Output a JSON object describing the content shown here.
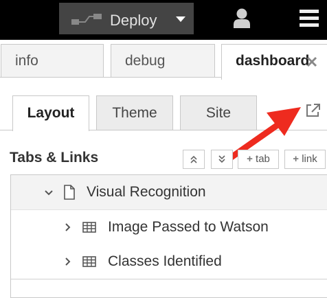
{
  "header": {
    "deploy_label": "Deploy",
    "icons": [
      "flow-icon",
      "caret-down-icon",
      "user-icon",
      "hamburger-menu-icon"
    ]
  },
  "sidebar": {
    "tabs": [
      {
        "label": "info",
        "active": false
      },
      {
        "label": "debug",
        "active": false
      },
      {
        "label": "dashboard",
        "active": true
      }
    ]
  },
  "dashboard": {
    "tabs": [
      {
        "label": "Layout",
        "active": true
      },
      {
        "label": "Theme",
        "active": false
      },
      {
        "label": "Site",
        "active": false
      }
    ],
    "section_title": "Tabs & Links",
    "buttons": {
      "add_tab": "tab",
      "add_link": "link"
    },
    "tree": [
      {
        "label": "Visual Recognition",
        "type": "tab",
        "expanded": true
      },
      {
        "label": "Image Passed to Watson",
        "type": "group",
        "expanded": false
      },
      {
        "label": "Classes Identified",
        "type": "group",
        "expanded": false
      }
    ]
  },
  "colors": {
    "header_bg": "#000000",
    "deploy_bg": "#444444",
    "annotation_arrow": "#ee2b1f"
  }
}
